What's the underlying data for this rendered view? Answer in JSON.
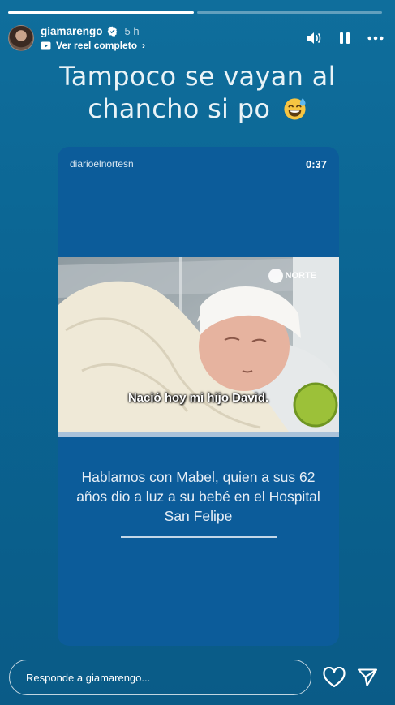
{
  "progress": [
    1.0,
    0.0
  ],
  "header": {
    "username": "giamarengo",
    "time": "5 h",
    "reel_link": "Ver reel completo",
    "chevron": "›"
  },
  "caption": {
    "line1": "Tampoco se vayan al",
    "line2": "chancho si po"
  },
  "card": {
    "handle": "diarioelnortesn",
    "duration": "0:37",
    "brand": "NORTE",
    "video_subtitle": "Nació hoy mi hijo David.",
    "text": "Hablamos con Mabel, quien a sus 62 años dio a luz a su bebé en el Hospital San Felipe"
  },
  "reply": {
    "placeholder": "Responde a giamarengo..."
  },
  "icons": [
    "verified-icon",
    "reel-icon",
    "volume-icon",
    "pause-icon",
    "more-icon",
    "sweat-smile-emoji",
    "heart-icon",
    "send-icon"
  ]
}
